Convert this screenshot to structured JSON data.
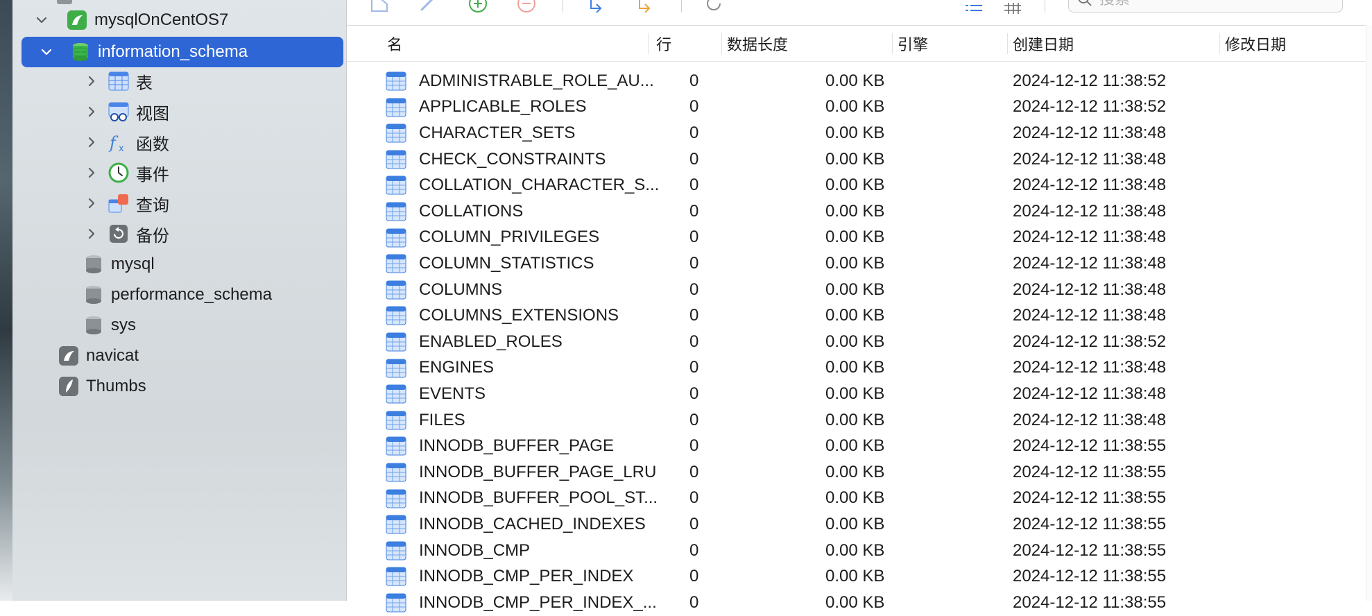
{
  "sidebar": {
    "connection": "mysqlOnCentOS7",
    "databases": [
      {
        "name": "information_schema",
        "selected": true
      },
      {
        "name": "mysql"
      },
      {
        "name": "performance_schema"
      },
      {
        "name": "sys"
      }
    ],
    "db_children": [
      "表",
      "视图",
      "函数",
      "事件",
      "查询",
      "备份"
    ],
    "other_connections": [
      "navicat",
      "Thumbs"
    ]
  },
  "toolbar": {
    "search_placeholder": "搜索"
  },
  "table": {
    "columns": [
      "名",
      "行",
      "数据长度",
      "引擎",
      "创建日期",
      "修改日期"
    ],
    "rows": [
      {
        "name": "ADMINISTRABLE_ROLE_AU...",
        "rows": "0",
        "size": "0.00 KB",
        "engine": "",
        "created": "2024-12-12 11:38:52",
        "modified": ""
      },
      {
        "name": "APPLICABLE_ROLES",
        "rows": "0",
        "size": "0.00 KB",
        "engine": "",
        "created": "2024-12-12 11:38:52",
        "modified": ""
      },
      {
        "name": "CHARACTER_SETS",
        "rows": "0",
        "size": "0.00 KB",
        "engine": "",
        "created": "2024-12-12 11:38:48",
        "modified": ""
      },
      {
        "name": "CHECK_CONSTRAINTS",
        "rows": "0",
        "size": "0.00 KB",
        "engine": "",
        "created": "2024-12-12 11:38:48",
        "modified": ""
      },
      {
        "name": "COLLATION_CHARACTER_S...",
        "rows": "0",
        "size": "0.00 KB",
        "engine": "",
        "created": "2024-12-12 11:38:48",
        "modified": ""
      },
      {
        "name": "COLLATIONS",
        "rows": "0",
        "size": "0.00 KB",
        "engine": "",
        "created": "2024-12-12 11:38:48",
        "modified": ""
      },
      {
        "name": "COLUMN_PRIVILEGES",
        "rows": "0",
        "size": "0.00 KB",
        "engine": "",
        "created": "2024-12-12 11:38:48",
        "modified": ""
      },
      {
        "name": "COLUMN_STATISTICS",
        "rows": "0",
        "size": "0.00 KB",
        "engine": "",
        "created": "2024-12-12 11:38:48",
        "modified": ""
      },
      {
        "name": "COLUMNS",
        "rows": "0",
        "size": "0.00 KB",
        "engine": "",
        "created": "2024-12-12 11:38:48",
        "modified": ""
      },
      {
        "name": "COLUMNS_EXTENSIONS",
        "rows": "0",
        "size": "0.00 KB",
        "engine": "",
        "created": "2024-12-12 11:38:48",
        "modified": ""
      },
      {
        "name": "ENABLED_ROLES",
        "rows": "0",
        "size": "0.00 KB",
        "engine": "",
        "created": "2024-12-12 11:38:52",
        "modified": ""
      },
      {
        "name": "ENGINES",
        "rows": "0",
        "size": "0.00 KB",
        "engine": "",
        "created": "2024-12-12 11:38:48",
        "modified": ""
      },
      {
        "name": "EVENTS",
        "rows": "0",
        "size": "0.00 KB",
        "engine": "",
        "created": "2024-12-12 11:38:48",
        "modified": ""
      },
      {
        "name": "FILES",
        "rows": "0",
        "size": "0.00 KB",
        "engine": "",
        "created": "2024-12-12 11:38:48",
        "modified": ""
      },
      {
        "name": "INNODB_BUFFER_PAGE",
        "rows": "0",
        "size": "0.00 KB",
        "engine": "",
        "created": "2024-12-12 11:38:55",
        "modified": ""
      },
      {
        "name": "INNODB_BUFFER_PAGE_LRU",
        "rows": "0",
        "size": "0.00 KB",
        "engine": "",
        "created": "2024-12-12 11:38:55",
        "modified": ""
      },
      {
        "name": "INNODB_BUFFER_POOL_ST...",
        "rows": "0",
        "size": "0.00 KB",
        "engine": "",
        "created": "2024-12-12 11:38:55",
        "modified": ""
      },
      {
        "name": "INNODB_CACHED_INDEXES",
        "rows": "0",
        "size": "0.00 KB",
        "engine": "",
        "created": "2024-12-12 11:38:55",
        "modified": ""
      },
      {
        "name": "INNODB_CMP",
        "rows": "0",
        "size": "0.00 KB",
        "engine": "",
        "created": "2024-12-12 11:38:55",
        "modified": ""
      },
      {
        "name": "INNODB_CMP_PER_INDEX",
        "rows": "0",
        "size": "0.00 KB",
        "engine": "",
        "created": "2024-12-12 11:38:55",
        "modified": ""
      },
      {
        "name": "INNODB_CMP_PER_INDEX_...",
        "rows": "0",
        "size": "0.00 KB",
        "engine": "",
        "created": "2024-12-12 11:38:55",
        "modified": ""
      }
    ]
  },
  "colors": {
    "selection": "#2f66d6",
    "sidebar_bg": "#d6dcdf",
    "table_icon": "#3d7fe0"
  }
}
